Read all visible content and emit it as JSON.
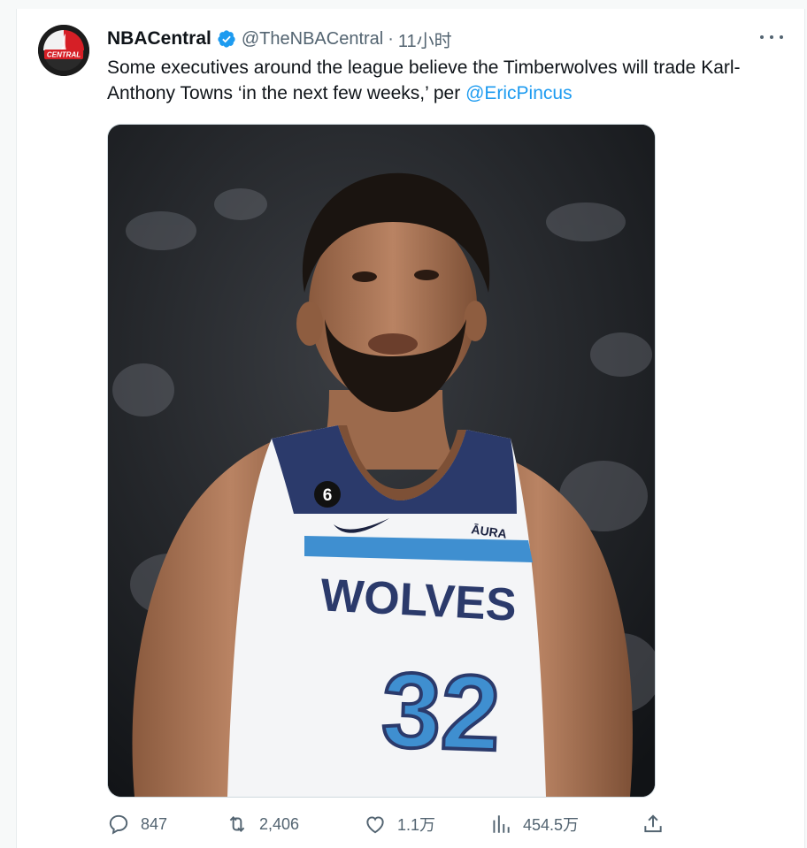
{
  "tweet": {
    "author_name": "NBACentral",
    "handle": "@TheNBACentral",
    "separator": "·",
    "time": "11小时",
    "avatar_text": "CENTRAL",
    "text_main": "Some executives around the league believe the Timberwolves will trade Karl-Anthony Towns ‘in the next few weeks,’ per ",
    "text_mention": "@EricPincus"
  },
  "media": {
    "jersey_team": "WOLVES",
    "jersey_number": "32",
    "patch_number": "6",
    "sponsor": "ĀURA"
  },
  "actions": {
    "replies": "847",
    "retweets": "2,406",
    "likes": "1.1万",
    "views": "454.5万"
  },
  "icons": [
    "verified-badge-icon",
    "more-icon",
    "reply-icon",
    "retweet-icon",
    "like-icon",
    "views-icon",
    "share-icon"
  ],
  "colors": {
    "accent": "#1d9bf0",
    "text": "#0f1419",
    "secondary": "#536471",
    "jersey_navy": "#2b3a6b",
    "jersey_blue": "#3f8fd0"
  }
}
